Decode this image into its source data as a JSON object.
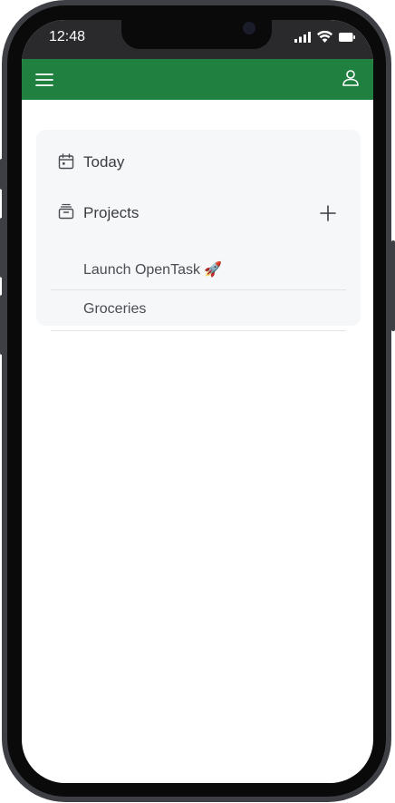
{
  "status_bar": {
    "time": "12:48"
  },
  "app_bar": {
    "menu_icon": "hamburger-menu-icon",
    "account_icon": "user-icon",
    "brand_color": "#1f8040"
  },
  "nav": {
    "today": {
      "label": "Today",
      "icon": "calendar-icon"
    },
    "projects": {
      "label": "Projects",
      "icon": "archive-box-icon",
      "add_icon": "plus-icon",
      "items": [
        {
          "label": "Launch OpenTask 🚀"
        },
        {
          "label": "Groceries"
        }
      ]
    }
  }
}
